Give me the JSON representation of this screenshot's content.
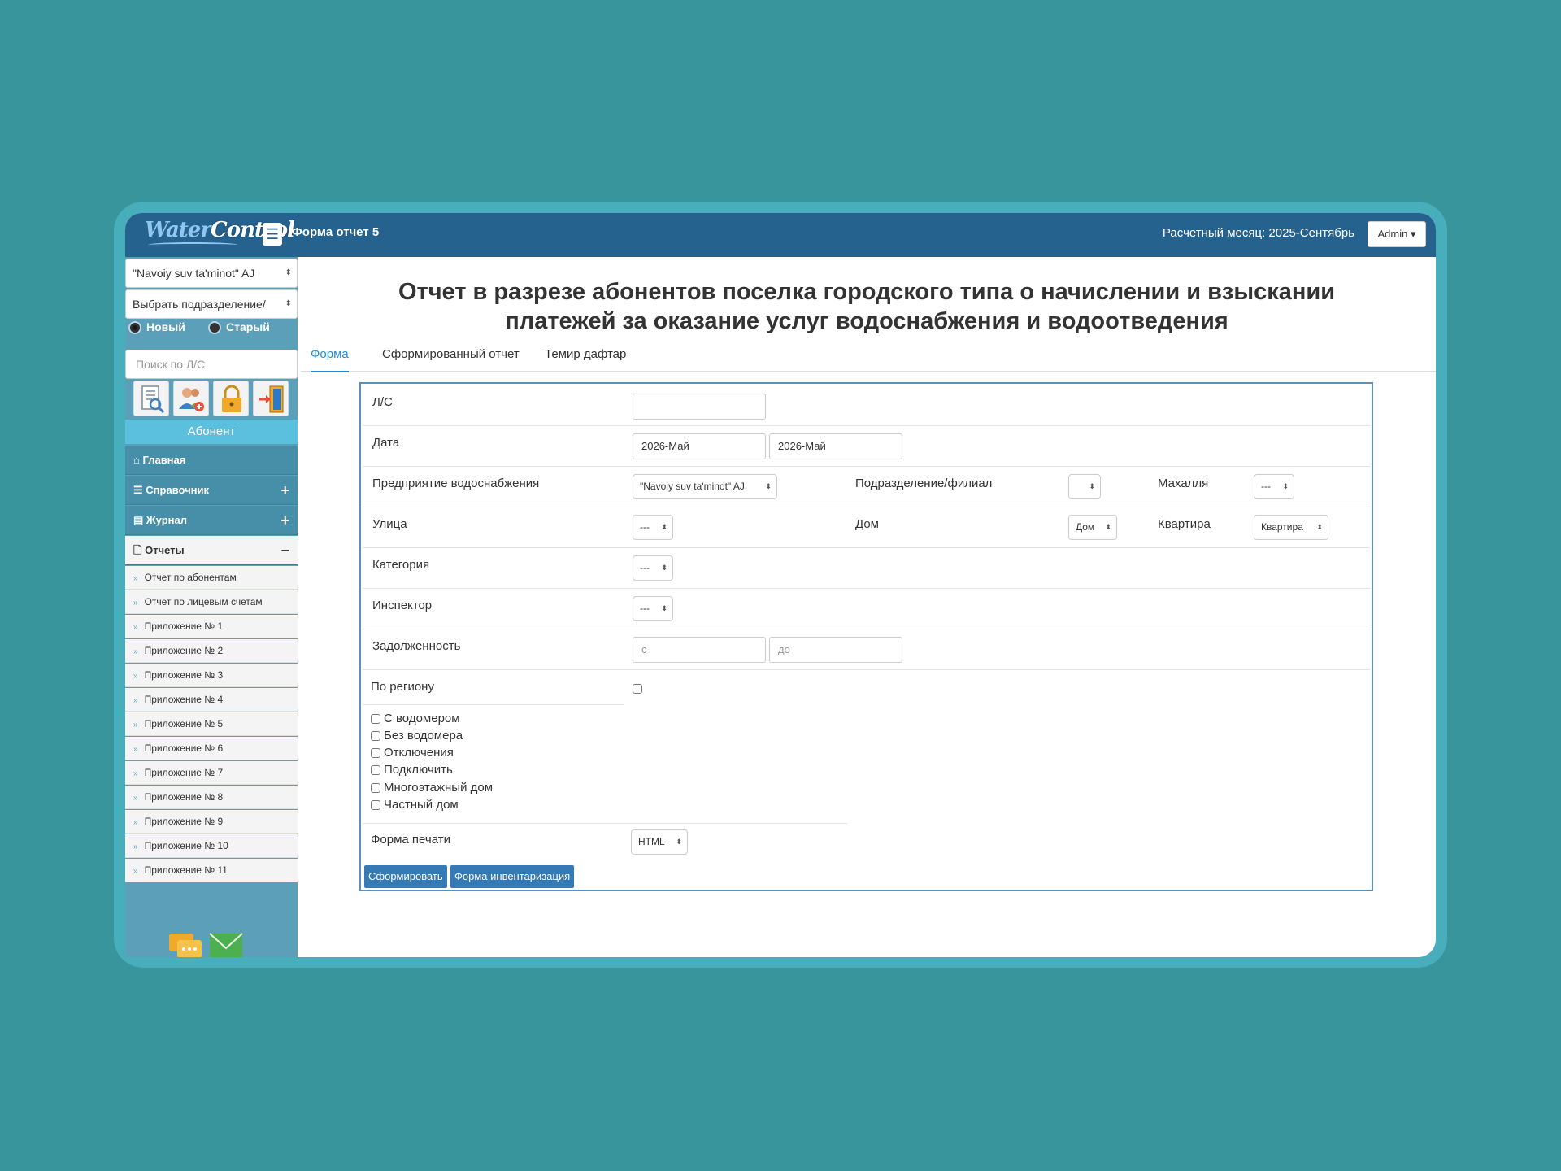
{
  "app": {
    "logo_part1": "Water",
    "logo_part2": "Control",
    "page_title": "Форма отчет 5",
    "period": "Расчетный месяц: 2025-Сентябрь",
    "admin_label": "Admin"
  },
  "sidebar": {
    "enterprise_select": "\"Navoiy suv ta'minot\" AJ",
    "division_select": "Выбрать подразделение/",
    "radio_new": "Новый",
    "radio_old": "Старый",
    "search_placeholder": "Поиск по Л/С",
    "icons": [
      "search-document-icon",
      "add-user-icon",
      "lock-icon",
      "logout-door-icon"
    ],
    "abonent_button": "Абонент",
    "menu": [
      {
        "label": "Главная",
        "icon": "home-icon"
      },
      {
        "label": "Справочник",
        "icon": "list-icon",
        "toggle": "+"
      },
      {
        "label": "Журнал",
        "icon": "table-icon",
        "toggle": "+"
      },
      {
        "label": "Отчеты",
        "icon": "file-icon",
        "toggle": "−"
      }
    ],
    "reports": [
      "Отчет по абонентам",
      "Отчет по лицевым счетам",
      "Приложение № 1",
      "Приложение № 2",
      "Приложение № 3",
      "Приложение № 4",
      "Приложение № 5",
      "Приложение № 6",
      "Приложение № 7",
      "Приложение № 8",
      "Приложение № 9",
      "Приложение № 10",
      "Приложение № 11"
    ],
    "bottom_icons": [
      "chat-icon",
      "mail-icon"
    ]
  },
  "main": {
    "heading_line1": "Отчет в разрезе абонентов поселка городского типа о начислении и взыскании",
    "heading_line2": "платежей за оказание услуг водоснабжения и водоотведения",
    "tabs": [
      "Форма",
      "Сформированный отчет",
      "Темир дафтар"
    ]
  },
  "form": {
    "ls_label": "Л/С",
    "ls_value": "",
    "date_label": "Дата",
    "date_from": "2026-Май",
    "date_to": "2026-Май",
    "enterprise_label": "Предприятие водоснабжения",
    "enterprise_value": "\"Navoiy suv ta'minot\" AJ",
    "division_label": "Подразделение/филиал",
    "division_value": "",
    "mahalla_label": "Махалля",
    "mahalla_value": "---",
    "street_label": "Улица",
    "street_value": "---",
    "house_label": "Дом",
    "house_value": "Дом",
    "apartment_label": "Квартира",
    "apartment_value": "Квартира",
    "category_label": "Категория",
    "category_value": "---",
    "inspector_label": "Инспектор",
    "inspector_value": "---",
    "debt_label": "Задолженность",
    "debt_from_placeholder": "с",
    "debt_to_placeholder": "до",
    "region_label": "По региону",
    "checkboxes": [
      "С водомером",
      "Без водомера",
      "Отключения",
      "Подключить",
      "Многоэтажный дом",
      "Частный дом"
    ],
    "print_form_label": "Форма печати",
    "print_form_value": "HTML",
    "submit_label": "Сформировать",
    "inventory_label": "Форма инвентаризация"
  },
  "colors": {
    "background": "#37959b",
    "topbar": "#25628e",
    "sidebar": "#5c9fb9",
    "accent": "#337ab7",
    "tab_active": "#1e8bd8"
  }
}
